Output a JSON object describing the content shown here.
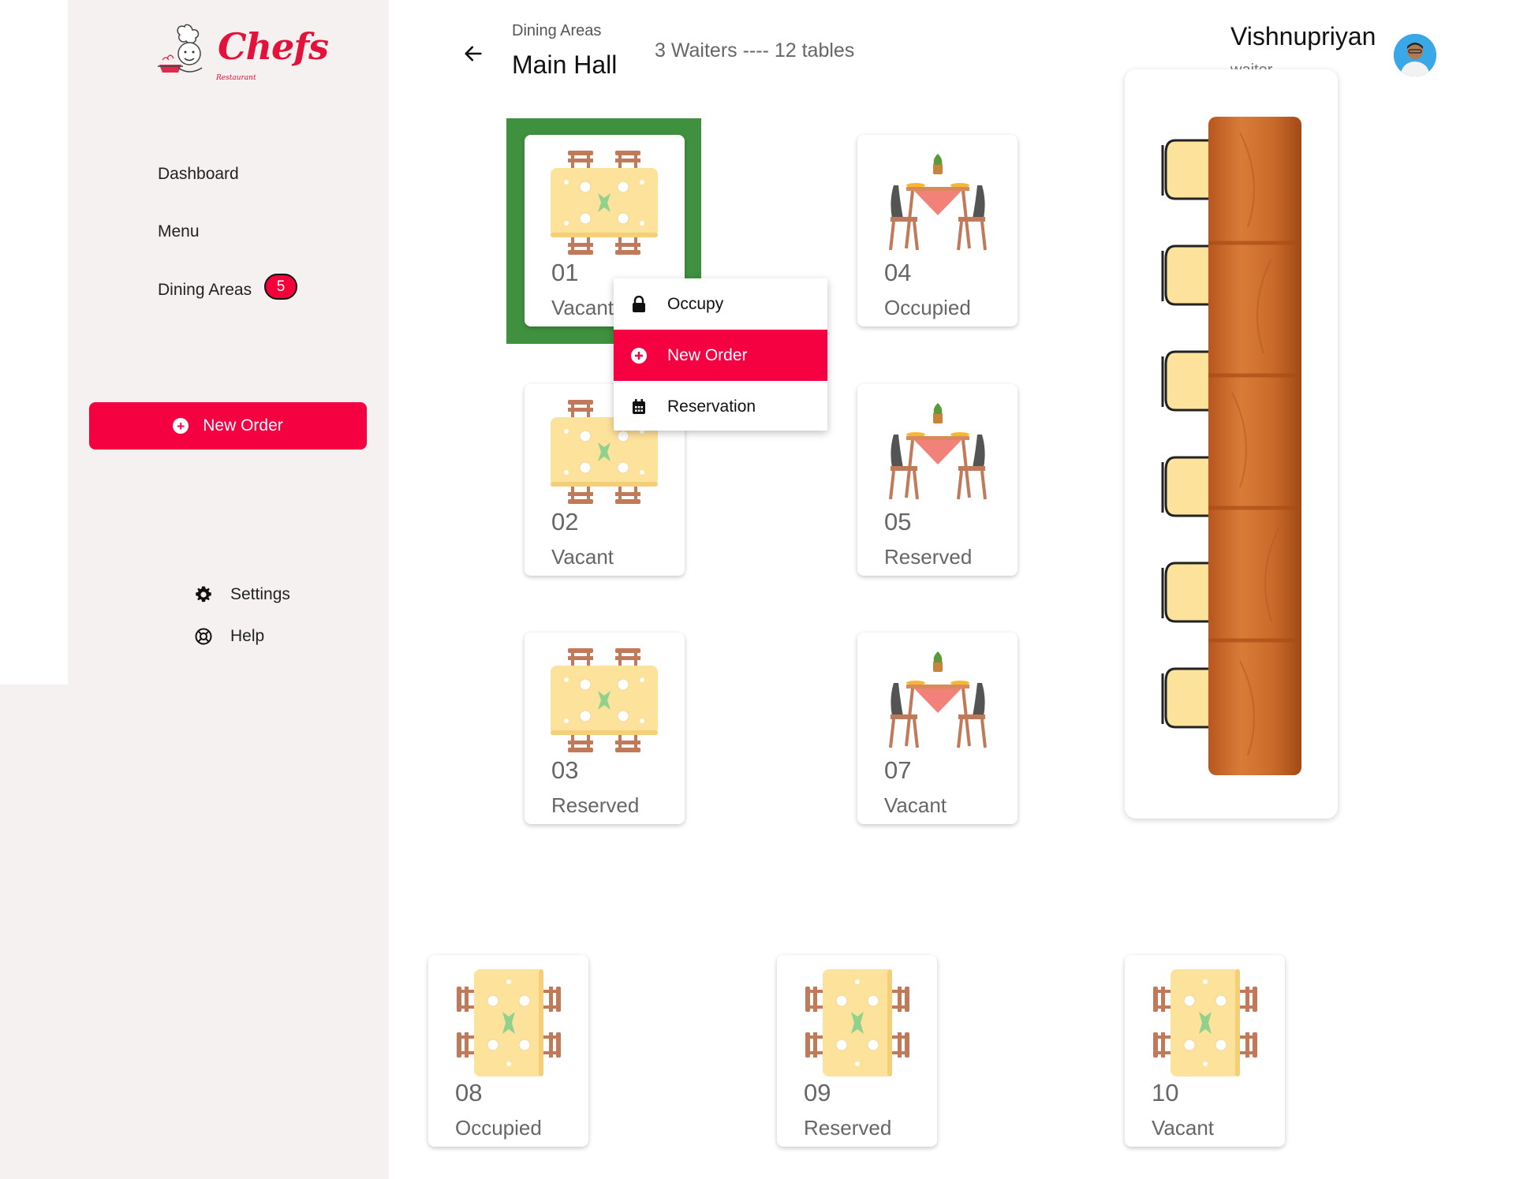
{
  "brand": {
    "name": "Chefs",
    "tagline": "Restaurant"
  },
  "sidebar": {
    "nav": [
      {
        "label": "Dashboard"
      },
      {
        "label": "Menu"
      },
      {
        "label": "Dining Areas",
        "badge": "5"
      }
    ],
    "new_order_label": "New Order",
    "settings_label": "Settings",
    "help_label": "Help"
  },
  "header": {
    "breadcrumb": "Dining Areas",
    "title": "Main Hall",
    "summary": "3 Waiters ---- 12 tables"
  },
  "user": {
    "name": "Vishnupriyan",
    "role": "waiter"
  },
  "tables": [
    {
      "number": "01",
      "status": "Vacant",
      "style": "square-table",
      "selected": true
    },
    {
      "number": "02",
      "status": "Vacant",
      "style": "square-table"
    },
    {
      "number": "03",
      "status": "Reserved",
      "style": "square-table"
    },
    {
      "number": "04",
      "status": "Occupied",
      "style": "dining-set"
    },
    {
      "number": "05",
      "status": "Reserved",
      "style": "dining-set"
    },
    {
      "number": "07",
      "status": "Vacant",
      "style": "dining-set"
    },
    {
      "number": "08",
      "status": "Occupied",
      "style": "long-table"
    },
    {
      "number": "09",
      "status": "Reserved",
      "style": "long-table"
    },
    {
      "number": "10",
      "status": "Vacant",
      "style": "long-table"
    }
  ],
  "context_menu": {
    "items": [
      {
        "label": "Occupy",
        "icon": "lock-icon"
      },
      {
        "label": "New Order",
        "icon": "plus-circle-icon",
        "active": true
      },
      {
        "label": "Reservation",
        "icon": "calendar-icon"
      }
    ]
  },
  "colors": {
    "accent": "#f50040",
    "selected": "#3f913f",
    "sidebar_bg": "#f4f1f0"
  }
}
